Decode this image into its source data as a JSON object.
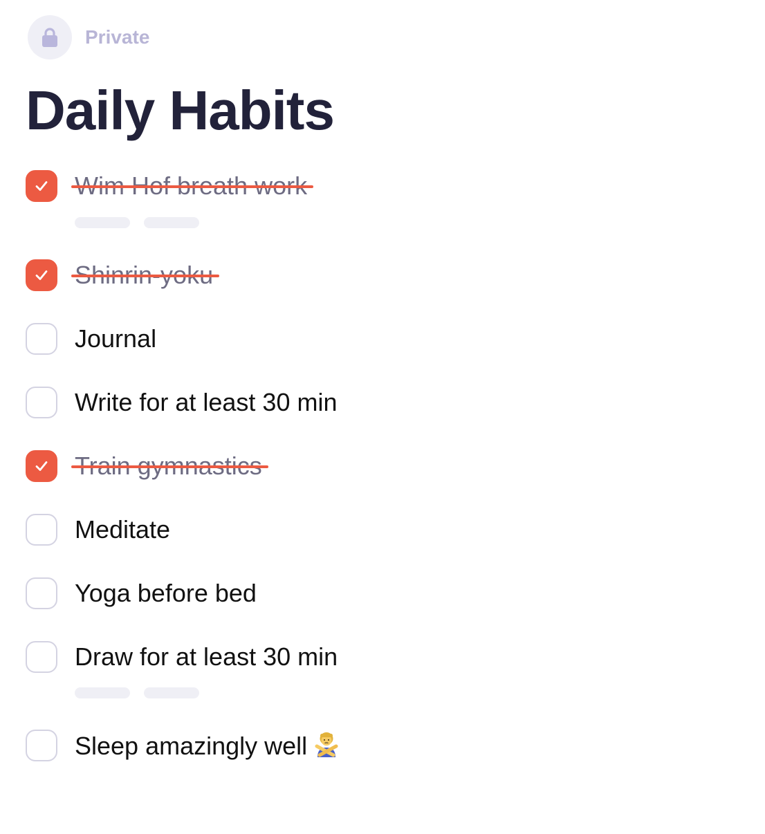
{
  "privacy": {
    "icon": "lock-icon",
    "label": "Private"
  },
  "title": "Daily Habits",
  "colors": {
    "accent": "#ec5a42",
    "title": "#22223a",
    "muted": "#b8b5d6"
  },
  "habits": [
    {
      "label": "Wim Hof breath work",
      "checked": true
    },
    {
      "label": "Shinrin-yoku",
      "checked": true
    },
    {
      "label": "Journal",
      "checked": false
    },
    {
      "label": "Write for at least 30 min",
      "checked": false
    },
    {
      "label": "Train gymnastics",
      "checked": true
    },
    {
      "label": "Meditate",
      "checked": false
    },
    {
      "label": "Yoga before bed",
      "checked": false
    },
    {
      "label": "Draw for at least 30 min",
      "checked": false
    },
    {
      "label": "Sleep amazingly well",
      "checked": false,
      "emoji": "person-gesturing-no-icon"
    }
  ]
}
